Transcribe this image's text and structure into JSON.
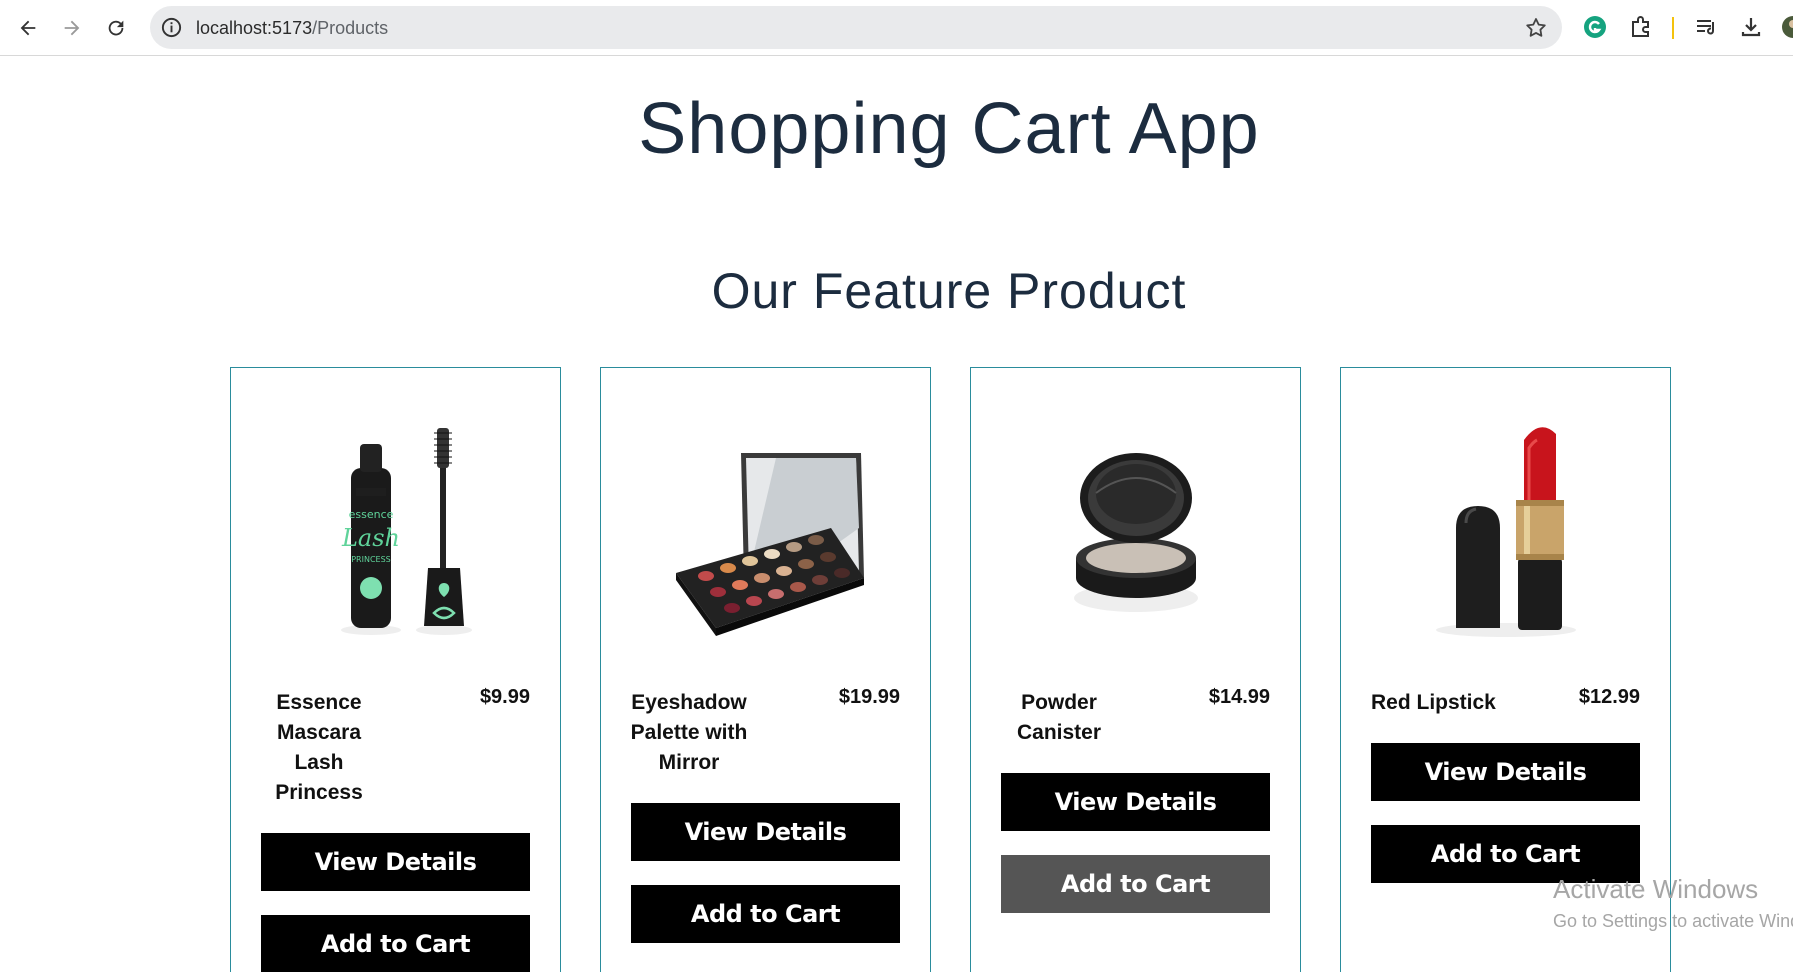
{
  "browser": {
    "url_host": "localhost:5173",
    "url_path": "/Products"
  },
  "page": {
    "title": "Shopping Cart App",
    "section_title": "Our Feature Product"
  },
  "products": [
    {
      "name": "Essence Mascara Lash Princess",
      "price": "$9.99",
      "view_label": "View Details",
      "cart_label": "Add to Cart"
    },
    {
      "name": "Eyeshadow Palette with Mirror",
      "price": "$19.99",
      "view_label": "View Details",
      "cart_label": "Add to Cart"
    },
    {
      "name": "Powder Canister",
      "price": "$14.99",
      "view_label": "View Details",
      "cart_label": "Add to Cart"
    },
    {
      "name": "Red Lipstick",
      "price": "$12.99",
      "view_label": "View Details",
      "cart_label": "Add to Cart"
    }
  ],
  "watermark": {
    "line1": "Activate Windows",
    "line2": "Go to Settings to activate Windows."
  },
  "colors": {
    "card_border": "#2a8c9c",
    "button_bg": "#000000",
    "button_hover_bg": "#555555",
    "title_color": "#1c2c3f"
  }
}
